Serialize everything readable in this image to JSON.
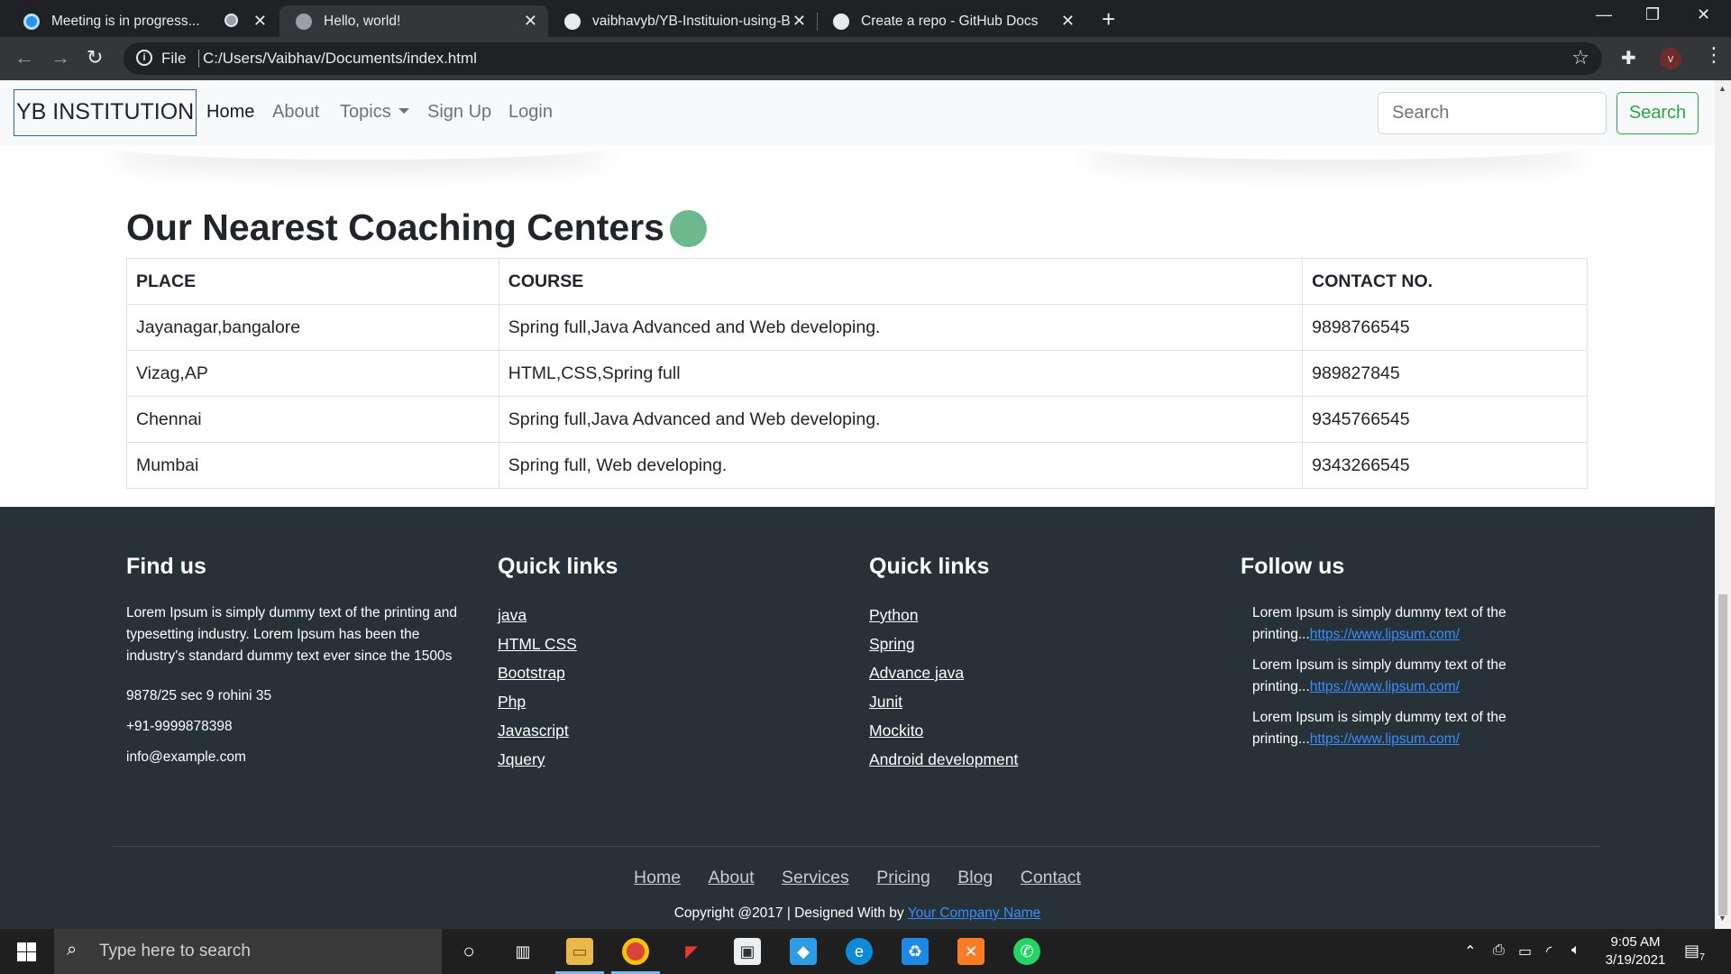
{
  "browser": {
    "tabs": [
      {
        "title": "Meeting is in progress...",
        "favicon_color": "#2196f3",
        "active": false
      },
      {
        "title": "Hello, world!",
        "favicon_color": "#9aa0a6",
        "active": true
      },
      {
        "title": "vaibhavyb/YB-Instituion-using-B",
        "favicon_color": "#e8eaed",
        "active": false
      },
      {
        "title": "Create a repo - GitHub Docs",
        "favicon_color": "#e8eaed",
        "active": false
      }
    ],
    "url_scheme_label": "File",
    "url": "C:/Users/Vaibhav/Documents/index.html",
    "avatar_letter": "v"
  },
  "navbar": {
    "brand": "YB INSTITUTION",
    "links": [
      "Home",
      "About",
      "Topics",
      "Sign Up",
      "Login"
    ],
    "search_placeholder": "Search",
    "search_button": "Search"
  },
  "centers": {
    "title": "Our Nearest Coaching Centers",
    "accent_color": "#6db88f",
    "headers": [
      "PLACE",
      "COURSE",
      "CONTACT NO."
    ],
    "rows": [
      [
        "Jayanagar,bangalore",
        "Spring full,Java Advanced and Web developing.",
        "9898766545"
      ],
      [
        "Vizag,AP",
        "HTML,CSS,Spring full",
        "989827845"
      ],
      [
        "Chennai",
        "Spring full,Java Advanced and Web developing.",
        "9345766545"
      ],
      [
        "Mumbai",
        "Spring full, Web developing.",
        "9343266545"
      ]
    ]
  },
  "footer": {
    "find_us": {
      "heading": "Find us",
      "text": "Lorem Ipsum is simply dummy text of the printing and typesetting industry. Lorem Ipsum has been the industry's standard dummy text ever since the 1500s",
      "address": "9878/25 sec 9 rohini 35",
      "phone": "+91-9999878398",
      "email": "info@example.com"
    },
    "quick_links_1": {
      "heading": "Quick links",
      "links": [
        "java",
        "HTML CSS",
        "Bootstrap",
        "Php",
        "Javascript",
        "Jquery"
      ]
    },
    "quick_links_2": {
      "heading": "Quick links",
      "links": [
        "Python",
        "Spring",
        "Advance java",
        "Junit",
        "Mockito",
        "Android development"
      ]
    },
    "follow_us": {
      "heading": "Follow us",
      "items": [
        {
          "text": "Lorem Ipsum is simply dummy text of the printing...",
          "link": "https://www.lipsum.com/"
        },
        {
          "text": "Lorem Ipsum is simply dummy text of the printing...",
          "link": "https://www.lipsum.com/"
        },
        {
          "text": "Lorem Ipsum is simply dummy text of the printing...",
          "link": "https://www.lipsum.com/"
        }
      ]
    },
    "bottom_links": [
      "Home",
      "About",
      "Services",
      "Pricing",
      "Blog",
      "Contact"
    ],
    "copyright_text": "Copyright @2017 | Designed With by ",
    "copyright_link": "Your Company Name",
    "background": "#263238"
  },
  "taskbar": {
    "search_placeholder": "Type here to search",
    "time": "9:05 AM",
    "date": "3/19/2021",
    "notification_count": "7"
  }
}
